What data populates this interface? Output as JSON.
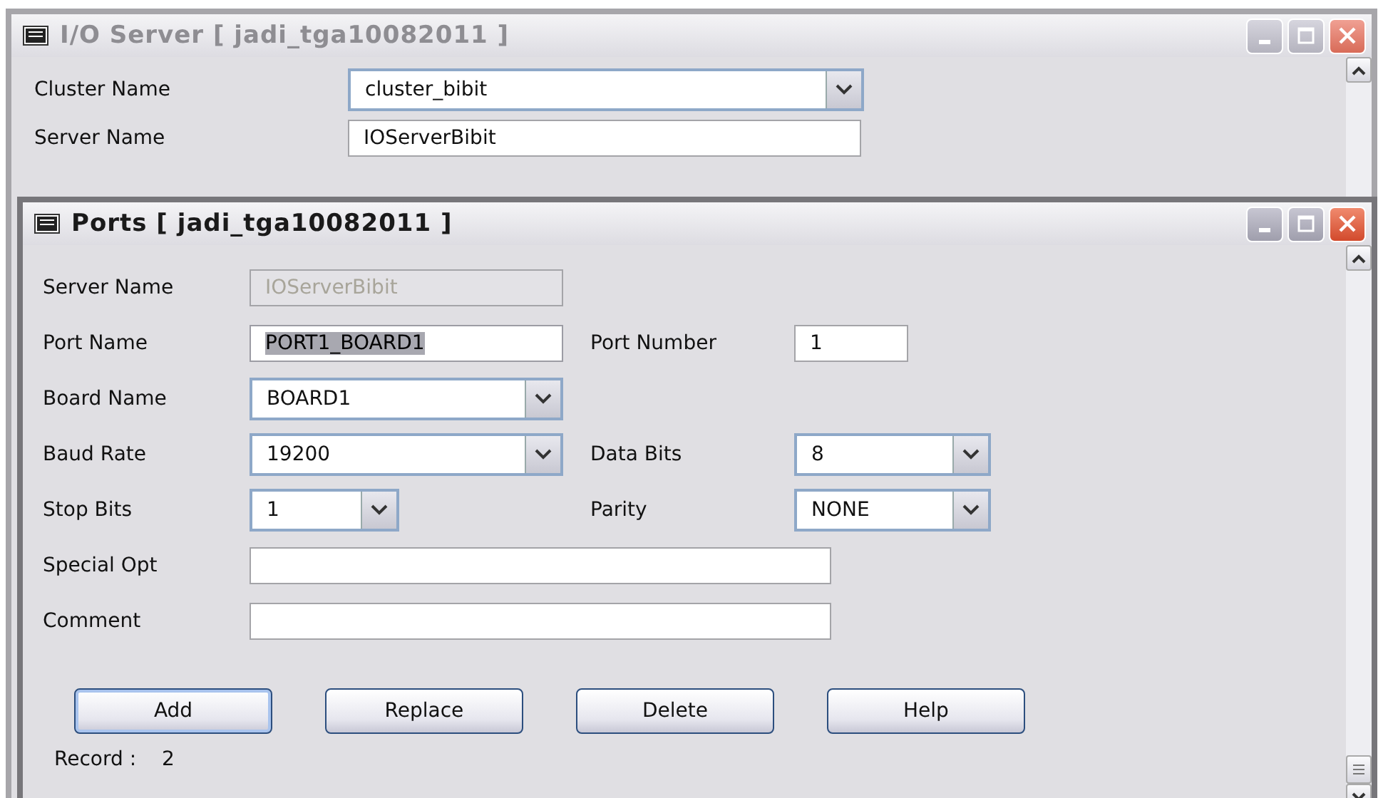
{
  "io_server_window": {
    "title": "I/O Server [ jadi_tga10082011 ]",
    "active": false,
    "fields": [
      {
        "label": "Cluster Name",
        "value": "cluster_bibit",
        "kind": "combo"
      },
      {
        "label": "Server Name",
        "value": "IOServerBibit",
        "kind": "text"
      }
    ]
  },
  "ports_window": {
    "title": "Ports [ jadi_tga10082011 ]",
    "active": true,
    "rows": [
      [
        {
          "label": "Server Name",
          "value": "IOServerBibit",
          "kind": "readonly"
        }
      ],
      [
        {
          "label": "Port Name",
          "value": "PORT1_BOARD1",
          "kind": "text",
          "highlighted": true
        },
        {
          "label": "Port Number",
          "value": "1",
          "kind": "text",
          "highlighted": false
        }
      ],
      [
        {
          "label": "Board Name",
          "value": "BOARD1",
          "kind": "combo"
        }
      ],
      [
        {
          "label": "Baud Rate",
          "value": "19200",
          "kind": "combo"
        },
        {
          "label": "Data Bits",
          "value": "8",
          "kind": "combo"
        }
      ],
      [
        {
          "label": "Stop Bits",
          "value": "1",
          "kind": "combo"
        },
        {
          "label": "Parity",
          "value": "NONE",
          "kind": "combo"
        }
      ],
      [
        {
          "label": "Special Opt",
          "kind": "text"
        }
      ],
      [
        {
          "label": "Comment",
          "kind": "text"
        }
      ]
    ],
    "buttons": [
      {
        "label": "Add",
        "selected": true
      },
      {
        "label": "Replace",
        "selected": false
      },
      {
        "label": "Delete",
        "selected": false
      },
      {
        "label": "Help",
        "selected": false
      }
    ],
    "record_label": "Record :",
    "record_value": "2"
  }
}
